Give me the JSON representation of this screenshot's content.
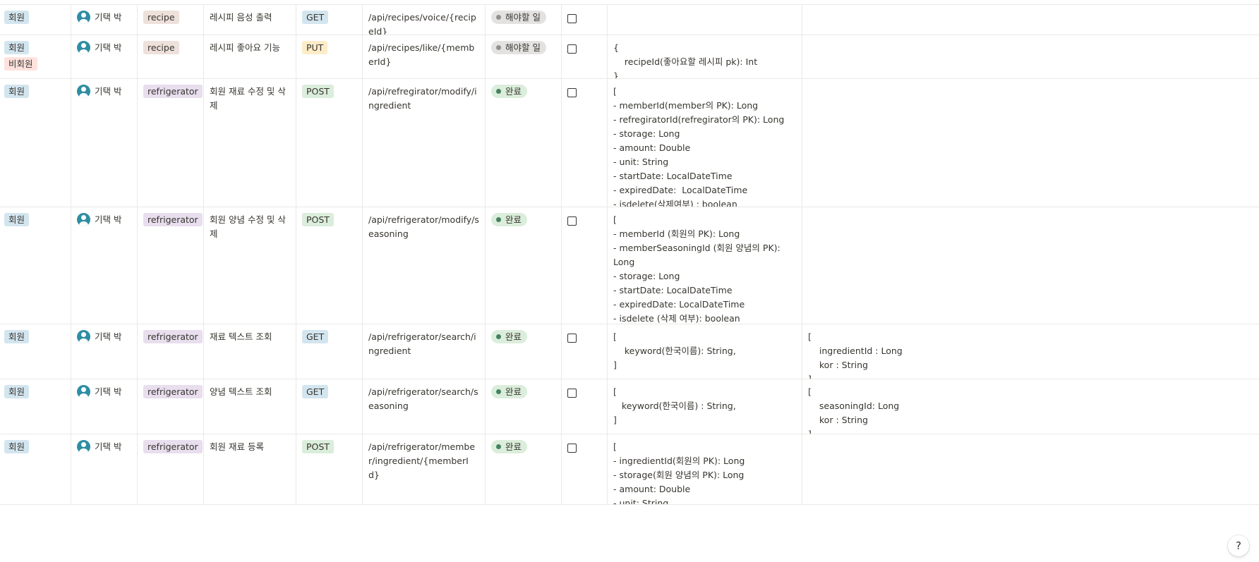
{
  "rows": [
    {
      "roles": [
        "회원"
      ],
      "assignee": "기택 박",
      "category": "recipe",
      "title": "레시피 음성 출력",
      "method": "GET",
      "endpoint": "/api/recipes/voice/{recipeId}",
      "status": "해야할 일",
      "status_type": "todo",
      "request": "",
      "response": ""
    },
    {
      "roles": [
        "회원",
        "비회원"
      ],
      "assignee": "기택 박",
      "category": "recipe",
      "title": "레시피 좋아요 기능",
      "method": "PUT",
      "endpoint": "/api/recipes/like/{memberId}",
      "status": "해야할 일",
      "status_type": "todo",
      "request": "{\n    recipeId(좋아요할 레시피 pk): Int\n}",
      "response": ""
    },
    {
      "roles": [
        "회원"
      ],
      "assignee": "기택 박",
      "category": "refrigerator",
      "title": "회원 재료 수정 및 삭제",
      "method": "POST",
      "endpoint": "/api/refregirator/modify/ingredient",
      "status": "완료",
      "status_type": "done",
      "request": "[\n- memberId(member의 PK): Long\n- refregiratorId(refregirator의 PK): Long\n- storage: Long\n- amount: Double\n- unit: String\n- startDate: LocalDateTime\n- expiredDate:  LocalDateTime\n- isdelete(삭제여부) : boolean\n]",
      "response": ""
    },
    {
      "roles": [
        "회원"
      ],
      "assignee": "기택 박",
      "category": "refrigerator",
      "title": "회원 양념 수정 및 삭제",
      "method": "POST",
      "endpoint": "/api/refrigerator/modify/seasoning",
      "status": "완료",
      "status_type": "done",
      "request": "[\n- memberId (회원의 PK): Long\n- memberSeasoningId (회원 양념의 PK):\nLong\n- storage: Long\n- startDate: LocalDateTime\n- expiredDate: LocalDateTime\n- isdelete (삭제 여부): boolean\n]",
      "response": ""
    },
    {
      "roles": [
        "회원"
      ],
      "assignee": "기택 박",
      "category": "refrigerator",
      "title": "재료 텍스트 조회",
      "method": "GET",
      "endpoint": "/api/refrigerator/search/ingredient",
      "status": "완료",
      "status_type": "done",
      "request": "[\n    keyword(한국이름): String,\n]",
      "response": "[\n    ingredientId : Long\n    kor : String\n]"
    },
    {
      "roles": [
        "회원"
      ],
      "assignee": "기택 박",
      "category": "refrigerator",
      "title": "양념 텍스트 조회",
      "method": "GET",
      "endpoint": "/api/refrigerator/search/seasoning",
      "status": "완료",
      "status_type": "done",
      "request": "[\n   keyword(한국이름) : String,\n]",
      "response": "[\n    seasoningId: Long\n    kor : String\n]"
    },
    {
      "roles": [
        "회원"
      ],
      "assignee": "기택 박",
      "category": "refrigerator",
      "title": "회원 재료 등록",
      "method": "POST",
      "endpoint": "/api/refrigerator/member/ingredient/{memberId}",
      "status": "완료",
      "status_type": "done",
      "request": "[\n- ingredientId(회원의 PK): Long\n- storage(회원 양념의 PK): Long\n- amount: Double\n- unit: String",
      "response": ""
    }
  ],
  "help_label": "?"
}
